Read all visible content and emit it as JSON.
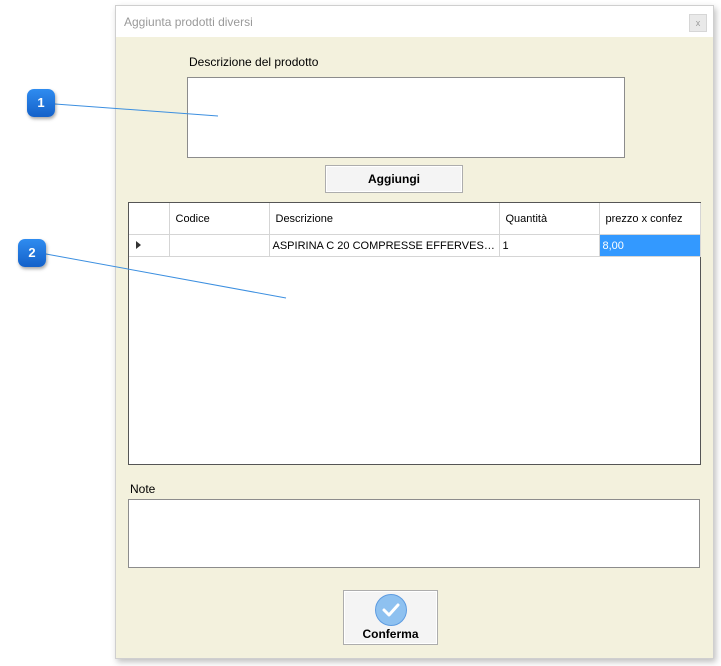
{
  "window": {
    "title": "Aggiunta prodotti diversi",
    "close_label": "x"
  },
  "form": {
    "description_label": "Descrizione del prodotto",
    "description_value": "",
    "add_button": "Aggiungi",
    "notes_label": "Note",
    "notes_value": "",
    "confirm_button": "Conferma"
  },
  "grid": {
    "columns": [
      "Codice",
      "Descrizione",
      "Quantità",
      "prezzo x confez"
    ],
    "rows": [
      {
        "codice": "",
        "descrizione": "ASPIRINA C 20 COMPRESSE EFFERVESC...",
        "quantita": "1",
        "prezzo": "8,00"
      }
    ]
  },
  "callouts": [
    "1",
    "2"
  ],
  "colors": {
    "window_bg": "#f3f1dd",
    "selection": "#3399ff",
    "callout": "#1e7ae0"
  }
}
